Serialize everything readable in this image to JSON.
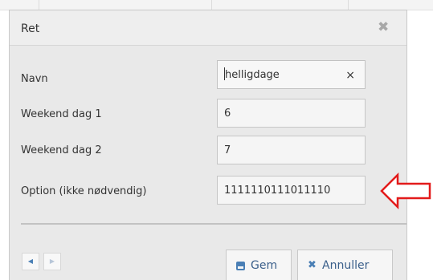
{
  "dialog": {
    "title": "Ret",
    "close_glyph": "✖"
  },
  "fields": [
    {
      "label": "Navn",
      "value": "helligdage",
      "clear_glyph": "×"
    },
    {
      "label": "Weekend dag 1",
      "value": "6"
    },
    {
      "label": "Weekend dag 2",
      "value": "7"
    },
    {
      "label": "Option (ikke nødvendig)",
      "value": "1111110111011110"
    }
  ],
  "pager": {
    "prev_glyph": "◀",
    "next_glyph": "▶"
  },
  "buttons": {
    "save_label": "Gem",
    "cancel_label": "Annuller",
    "cancel_glyph": "✖"
  },
  "icons": {
    "save": "floppy-disk-icon",
    "cancel": "x-icon",
    "annotation": "red-outline-arrow-icon"
  },
  "colors": {
    "accent": "#4a7fb5",
    "button_text": "#3a5f8a",
    "arrow": "#e31b1b",
    "dialog_bg": "#e9e9e9"
  }
}
